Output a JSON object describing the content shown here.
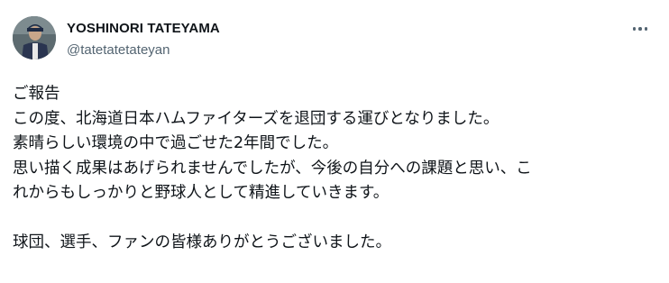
{
  "author": {
    "display_name": "YOSHINORI TATEYAMA",
    "handle": "@tatetatetateyan",
    "avatar_icon": "profile-photo"
  },
  "menu": {
    "icon": "more-horizontal-icon"
  },
  "post": {
    "lines": [
      "ご報告",
      "この度、北海道日本ハムファイターズを退団する運びとなりました。",
      "素晴らしい環境の中で過ごせた2年間でした。",
      "思い描く成果はあげられませんでしたが、今後の自分への課題と思い、こ",
      "れからもしっかりと野球人として精進していきます。",
      "",
      "球団、選手、ファンの皆様ありがとうございました。"
    ]
  },
  "colors": {
    "text_primary": "#0f1419",
    "text_secondary": "#536471",
    "background": "#ffffff"
  }
}
